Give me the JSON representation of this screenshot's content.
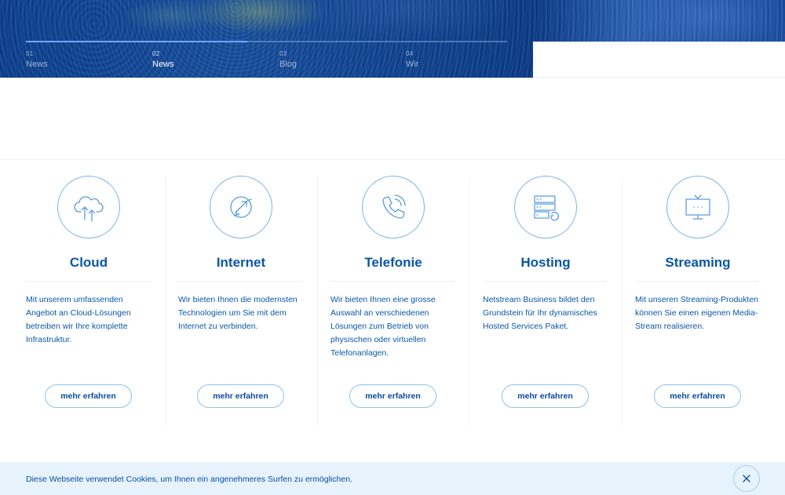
{
  "hero": {
    "slider_progress": 0.46,
    "slides": [
      {
        "number": "01",
        "label": "News",
        "active": false
      },
      {
        "number": "02",
        "label": "News",
        "active": true
      },
      {
        "number": "03",
        "label": "Blog",
        "active": false
      },
      {
        "number": "04",
        "label": "Wir",
        "active": false
      }
    ]
  },
  "services": [
    {
      "icon": "cloud-upload-icon",
      "title": "Cloud",
      "text": "Mit unserem umfassenden Angebot an Cloud-Lösungen betreiben wir Ihre komplette Infrastruktur.",
      "button": "mehr erfahren"
    },
    {
      "icon": "globe-arrows-icon",
      "title": "Internet",
      "text": "Wir bieten Ihnen die modernsten Technologien um Sie mit dem Internet zu verbinden.",
      "button": "mehr erfahren"
    },
    {
      "icon": "phone-signal-icon",
      "title": "Telefonie",
      "text": "Wir bieten Ihnen eine grosse Auswahl an verschiedenen Lösungen zum Betrieb von physischen oder virtuellen Telefonanlagen.",
      "button": "mehr erfahren"
    },
    {
      "icon": "server-icon",
      "title": "Hosting",
      "text": "Netstream Business bildet den Grundstein für Ihr dynamisches Hosted Services Paket.",
      "button": "mehr erfahren"
    },
    {
      "icon": "tv-icon",
      "title": "Streaming",
      "text": "Mit unseren Streaming-Produkten können Sie einen eigenen Media-Stream realisieren.",
      "button": "mehr erfahren"
    }
  ],
  "cookie": {
    "text": "Diese Webseite verwendet Cookies, um Ihnen ein angenehmeres Surfen zu ermöglichen.",
    "close_icon": "close-icon"
  },
  "colors": {
    "accent": "#0a56a8",
    "icon_stroke": "#5a9de0",
    "cookie_bg": "#e6f3fd"
  }
}
